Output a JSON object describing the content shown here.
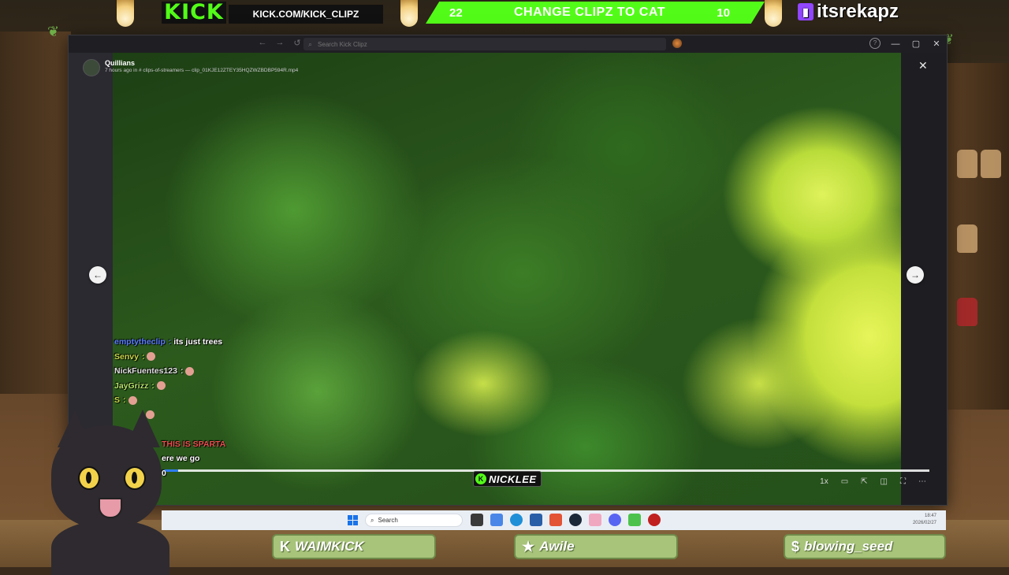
{
  "overlay": {
    "kick_logo": "KICK",
    "kick_url": "KICK.COM/KICK_CLIPZ",
    "vote": {
      "left_count": "22",
      "label": "CHANGE CLIPZ TO CAT",
      "right_count": "10"
    },
    "twitch_handle": "itsrekapz"
  },
  "window": {
    "search": {
      "placeholder": "Search Kick Clipz",
      "value": ""
    },
    "controls": {
      "minimize": "—",
      "maximize": "▢",
      "close": "✕"
    }
  },
  "viewer": {
    "author": "Quillians",
    "meta": "7 hours ago in # clips-of-streamers  —  clip_01KJE12ZTEY35HQZWZBDBP594R.mp4",
    "close": "✕",
    "prev": "←",
    "next": "→",
    "progress": 0.02,
    "controls": {
      "speed": "1x"
    }
  },
  "chat": [
    {
      "user": "emptytheclip",
      "msg": "its just trees",
      "color": "#5a7cff",
      "emote": false
    },
    {
      "user": "Senvy",
      "msg": "",
      "color": "#c9d64a",
      "emote": true
    },
    {
      "user": "NickFuentes123",
      "msg": "",
      "color": "#e0e0e0",
      "emote": true
    },
    {
      "user": "JayGrizz",
      "msg": "",
      "color": "#b6e36a",
      "emote": true
    },
    {
      "user": "S",
      "msg": "",
      "color": "#c9d64a",
      "emote": true
    },
    {
      "user": "",
      "msg": "",
      "color": "#ffffff",
      "emote": true
    },
    {
      "user": "",
      "msg": "",
      "color": "#ffffff",
      "emote": false
    },
    {
      "user": "",
      "msg": "THIS IS SPARTA",
      "color": "#e85050",
      "emote": false
    },
    {
      "user": "",
      "msg": "ere we go",
      "color": "#ffffff",
      "emote": false
    },
    {
      "user": "",
      "msg": "0",
      "color": "#ffffff",
      "emote": false
    }
  ],
  "nicklee": "NICKLEE",
  "taskbar": {
    "search_label": "Search",
    "time": "18:47",
    "date": "2026/02/27"
  },
  "bottom_labels": {
    "left": "WAIMKICK",
    "middle": "Awile",
    "right": "blowing_seed"
  }
}
